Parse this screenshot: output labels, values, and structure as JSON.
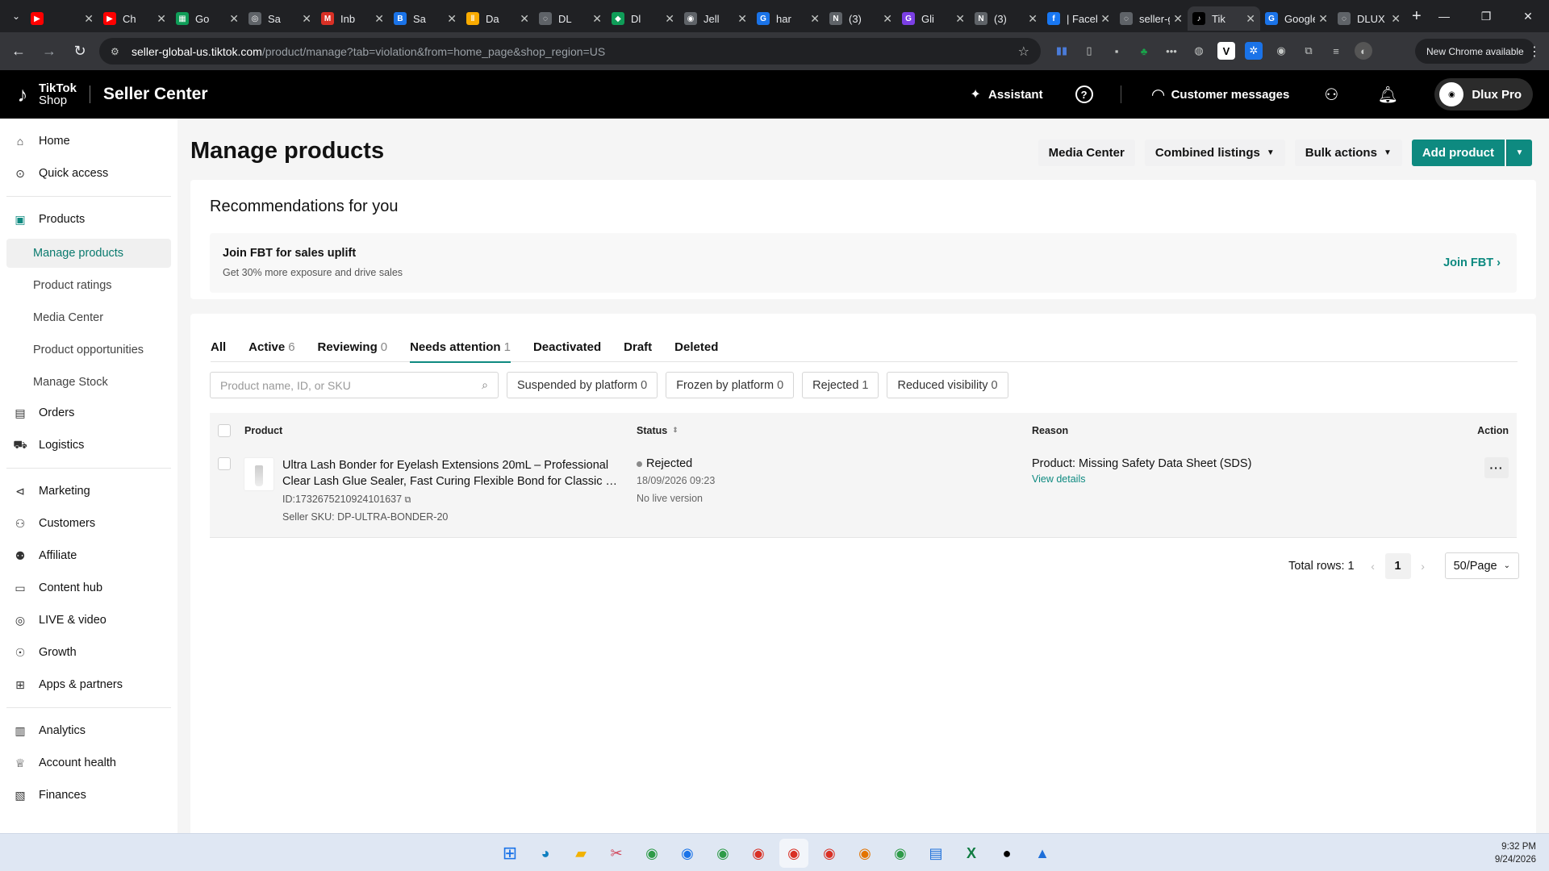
{
  "browser": {
    "tabs": [
      {
        "label": "",
        "fav": "▶",
        "color": "#ff0000"
      },
      {
        "label": "Ch",
        "fav": "▶",
        "color": "#ff0000"
      },
      {
        "label": "Go",
        "fav": "▦",
        "color": "#0f9d58"
      },
      {
        "label": "Sa",
        "fav": "◎",
        "color": "#5f6368"
      },
      {
        "label": "Inb",
        "fav": "M",
        "color": "#d93025"
      },
      {
        "label": "Sa",
        "fav": "B",
        "color": "#1a73e8"
      },
      {
        "label": "Da",
        "fav": "‖",
        "color": "#f9ab00"
      },
      {
        "label": "DL",
        "fav": "◌",
        "color": "#5f6368"
      },
      {
        "label": "Dl",
        "fav": "◆",
        "color": "#0f9d58"
      },
      {
        "label": "Jell",
        "fav": "◉",
        "color": "#5f6368"
      },
      {
        "label": "har",
        "fav": "G",
        "color": "#1a73e8"
      },
      {
        "label": "(3)",
        "fav": "N",
        "color": "#5f6368"
      },
      {
        "label": "Gli",
        "fav": "G",
        "color": "#7b3fe4"
      },
      {
        "label": "(3)",
        "fav": "N",
        "color": "#5f6368"
      },
      {
        "label": "| Facebo",
        "fav": "f",
        "color": "#1877f2"
      },
      {
        "label": "seller-g",
        "fav": "◌",
        "color": "#5f6368"
      },
      {
        "label": "Tik",
        "fav": "♪",
        "color": "#000000",
        "active": true
      },
      {
        "label": "Google",
        "fav": "G",
        "color": "#1a73e8"
      },
      {
        "label": "DLUX P",
        "fav": "◌",
        "color": "#5f6368"
      }
    ],
    "url_domain": "seller-global-us.tiktok.com",
    "url_path": "/product/manage?tab=violation&from=home_page&shop_region=US",
    "new_chrome": "New Chrome available"
  },
  "header": {
    "logo_line1": "TikTok",
    "logo_line2": "Shop",
    "app_name": "Seller Center",
    "assistant": "Assistant",
    "customer_messages": "Customer messages",
    "user_name": "Dlux Pro"
  },
  "sidebar": {
    "home": "Home",
    "quick_access": "Quick access",
    "products": "Products",
    "sub": [
      "Manage products",
      "Product ratings",
      "Media Center",
      "Product opportunities",
      "Manage Stock"
    ],
    "orders": "Orders",
    "logistics": "Logistics",
    "marketing": "Marketing",
    "customers": "Customers",
    "affiliate": "Affiliate",
    "content_hub": "Content hub",
    "live_video": "LIVE & video",
    "growth": "Growth",
    "apps_partners": "Apps & partners",
    "analytics": "Analytics",
    "account_health": "Account health",
    "finances": "Finances"
  },
  "main": {
    "title": "Manage products",
    "btn_media": "Media Center",
    "btn_combined": "Combined listings",
    "btn_bulk": "Bulk actions",
    "btn_add": "Add product",
    "reco_title": "Recommendations for you",
    "fbt_title": "Join FBT for sales uplift",
    "fbt_desc": "Get 30% more exposure and drive sales",
    "fbt_link": "Join FBT",
    "tabs": [
      {
        "label": "All",
        "count": ""
      },
      {
        "label": "Active",
        "count": "6"
      },
      {
        "label": "Reviewing",
        "count": "0"
      },
      {
        "label": "Needs attention",
        "count": "1"
      },
      {
        "label": "Deactivated",
        "count": ""
      },
      {
        "label": "Draft",
        "count": ""
      },
      {
        "label": "Deleted",
        "count": ""
      }
    ],
    "search_placeholder": "Product name, ID, or SKU",
    "chips": [
      {
        "label": "Suspended by platform",
        "count": "0"
      },
      {
        "label": "Frozen by platform",
        "count": "0"
      },
      {
        "label": "Rejected",
        "count": "1"
      },
      {
        "label": "Reduced visibility",
        "count": "0"
      }
    ],
    "columns": {
      "product": "Product",
      "status": "Status",
      "reason": "Reason",
      "action": "Action"
    },
    "row": {
      "name_line1": "Ultra Lash Bonder for Eyelash Extensions 20mL – Professional",
      "name_line2": "Clear Lash Glue Sealer, Fast Curing Flexible Bond for Classic &…",
      "id": "ID:1732675210924101637",
      "sku": "Seller SKU: DP-ULTRA-BONDER-20",
      "status": "Rejected",
      "status_date": "18/09/2026 09:23",
      "status_live": "No live version",
      "reason": "Product: Missing Safety Data Sheet (SDS)",
      "reason_link": "View details",
      "action": "···"
    },
    "pagination": {
      "total": "Total rows: 1",
      "page": "1",
      "size": "50/Page"
    }
  },
  "taskbar": {
    "time": "9:32 PM",
    "date": "9/24/2026"
  }
}
